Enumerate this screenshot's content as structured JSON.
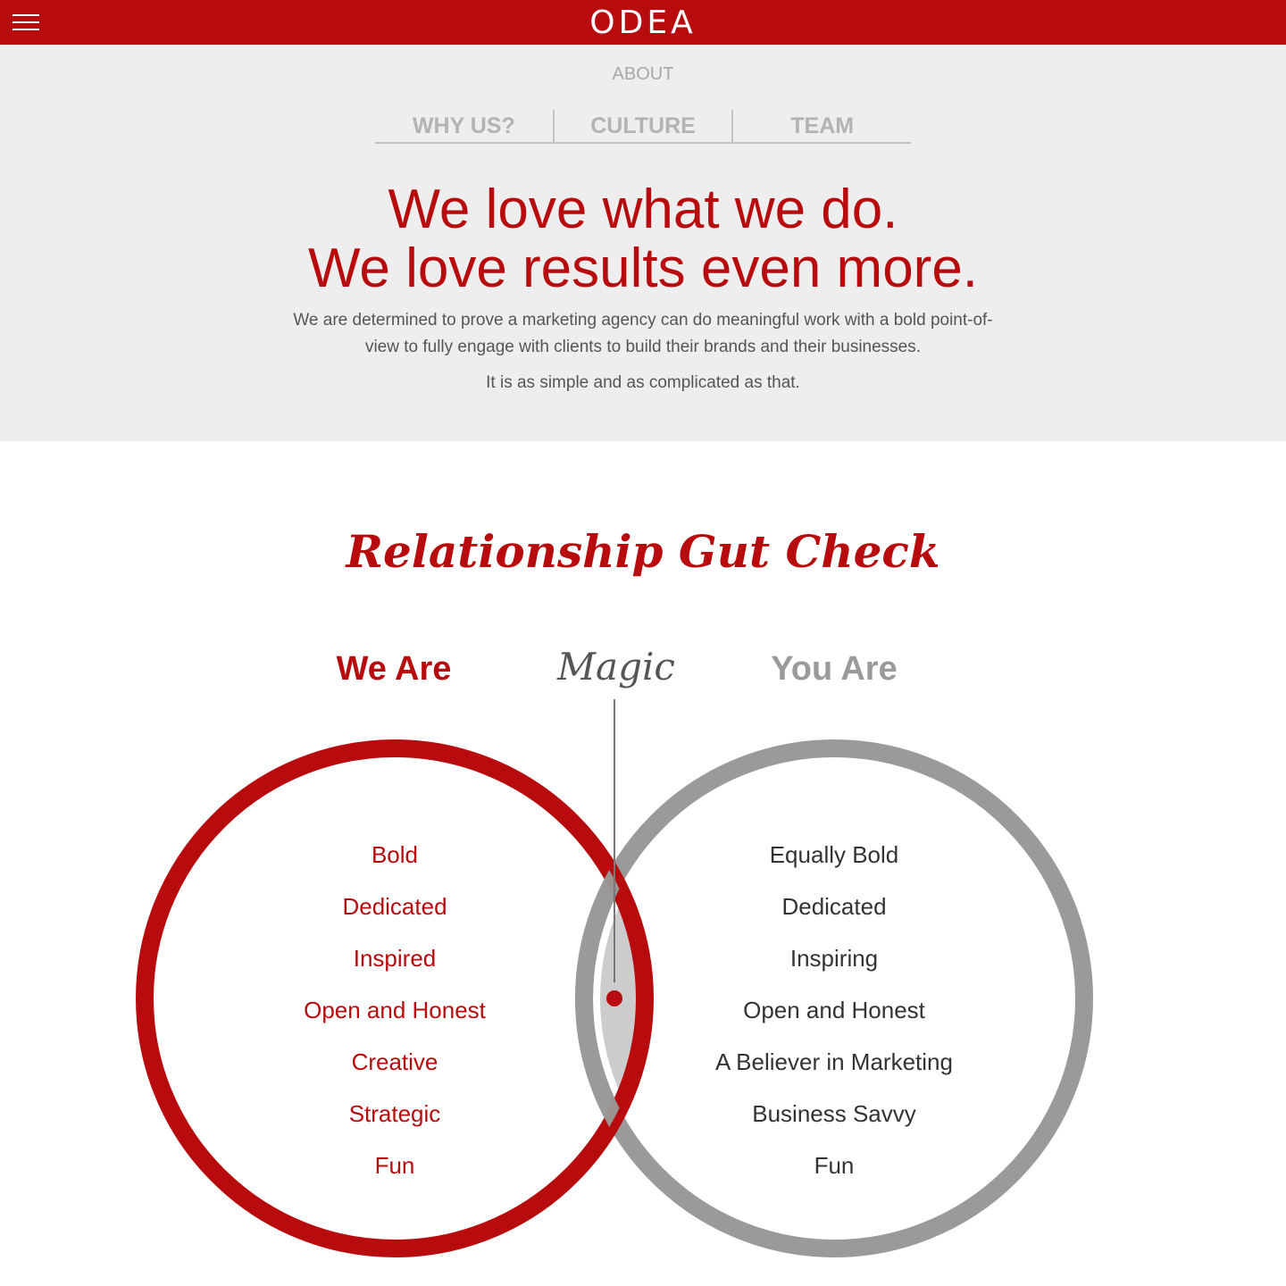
{
  "header": {
    "logo_text": "ODEA",
    "menu_icon": "hamburger-menu-icon",
    "brand_color": "#b70b0e"
  },
  "hero": {
    "section_label": "ABOUT",
    "tabs": [
      {
        "label": "WHY US?"
      },
      {
        "label": "CULTURE"
      },
      {
        "label": "TEAM"
      }
    ],
    "headline_line1": "We love what we do.",
    "headline_line2": "We love results even more.",
    "body": "We are determined to prove a marketing agency can do meaningful work with a bold point-of-view to fully engage with clients to build their brands and their businesses.",
    "body_2": "It is as simple and as complicated as that."
  },
  "gut_check": {
    "title": "Relationship Gut Check",
    "we_are": {
      "title": "We Are",
      "color": "#b70b0e",
      "items": [
        "Bold",
        "Dedicated",
        "Inspired",
        "Open and Honest",
        "Creative",
        "Strategic",
        "Fun"
      ]
    },
    "magic": {
      "label": "Magic",
      "fill_color": "#cccccc",
      "dot_color": "#b70b0e"
    },
    "you_are": {
      "title": "You Are",
      "color": "#9a9a9a",
      "items": [
        "Equally Bold",
        "Dedicated",
        "Inspiring",
        "Open and Honest",
        "A Believer in Marketing",
        "Business Savvy",
        "Fun"
      ]
    }
  }
}
